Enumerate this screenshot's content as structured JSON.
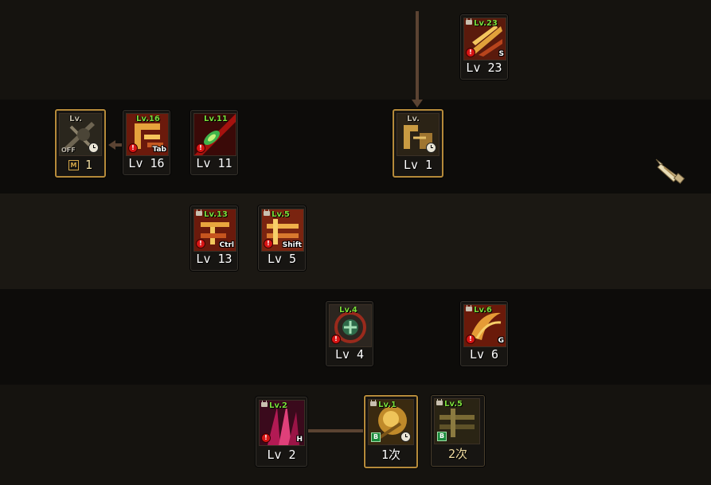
{
  "skills": {
    "s23": {
      "level_label": "Lv 23",
      "badge": "Lv.23",
      "hotkey": "S"
    },
    "s1top": {
      "level_label": "Lv 1",
      "badge": "Lv."
    },
    "off_skill": {
      "badge": "Lv.",
      "state": "OFF",
      "slot_mark": "M",
      "count_label": "1"
    },
    "s16": {
      "level_label": "Lv 16",
      "badge": "Lv.16",
      "hotkey": "Tab"
    },
    "s11": {
      "level_label": "Lv 11",
      "badge": "Lv.11"
    },
    "s13": {
      "level_label": "Lv 13",
      "badge": "Lv.13",
      "hotkey": "Ctrl"
    },
    "s5": {
      "level_label": "Lv 5",
      "badge": "Lv.5",
      "hotkey": "Shift"
    },
    "s4": {
      "level_label": "Lv 4",
      "badge": "Lv.4"
    },
    "s6": {
      "level_label": "Lv 6",
      "badge": "Lv.6",
      "hotkey": "G"
    },
    "s2": {
      "level_label": "Lv 2",
      "badge": "Lv.2",
      "hotkey": "H"
    },
    "first": {
      "level_label": "1次",
      "badge": "Lv.1",
      "mark": "B"
    },
    "second": {
      "level_label": "2次",
      "badge": "Lv.5",
      "mark": "B"
    }
  },
  "colors": {
    "connector": "#5b4332",
    "level_badge": "#7bdc3a",
    "alert": "#d81414",
    "highlight_border": "#b58a3a"
  },
  "icons": {
    "cursor": "scroll-cursor-icon",
    "lock": "lock-icon",
    "alert": "alert-icon",
    "cooldown": "clock-icon"
  }
}
